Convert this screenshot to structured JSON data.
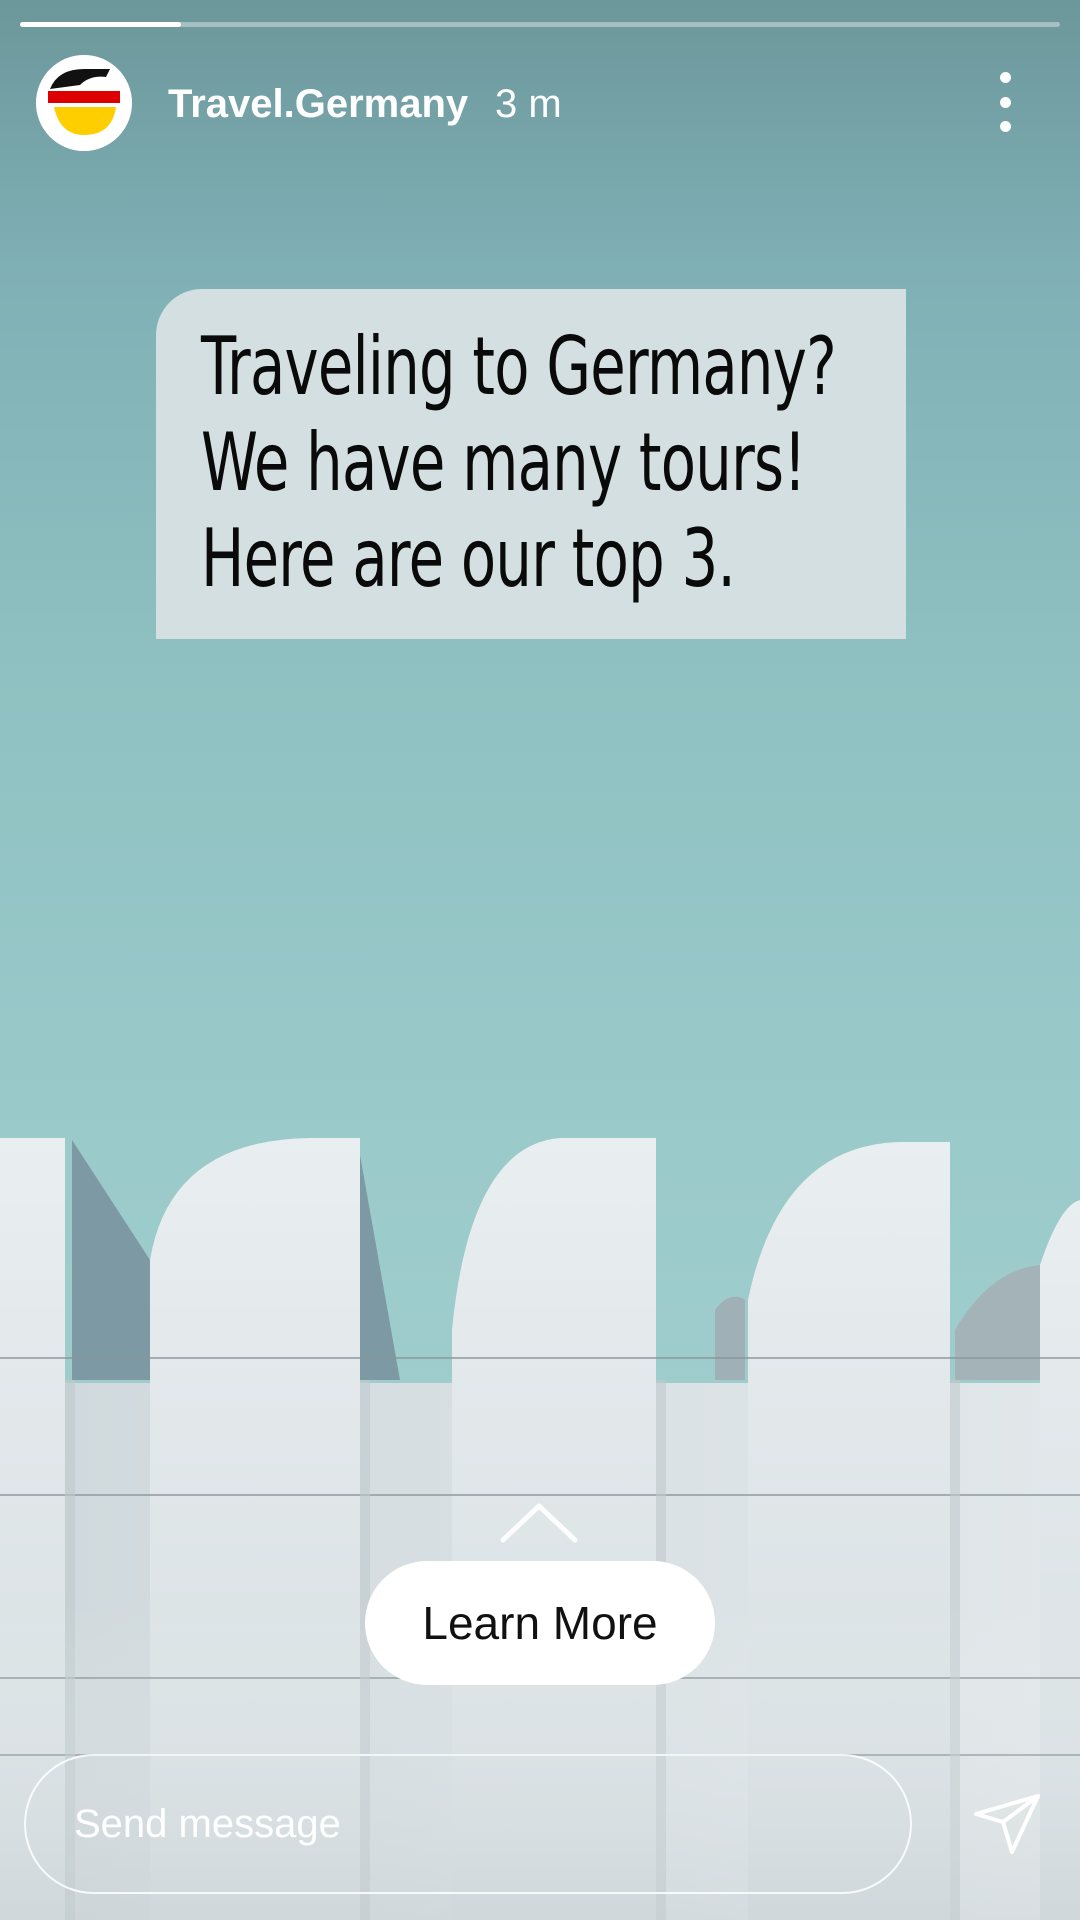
{
  "story": {
    "progress": 0.155
  },
  "header": {
    "username": "Travel.Germany",
    "time": "3 m",
    "avatar_icon": "germany-flag-logo",
    "more_icon": "more-vertical-icon"
  },
  "card": {
    "lines": [
      "Traveling to Germany?",
      "We have many tours!",
      "Here are our top 3."
    ]
  },
  "cta": {
    "icon": "chevron-up-icon",
    "label": "Learn More"
  },
  "message_bar": {
    "placeholder": "Send message",
    "send_icon": "send-icon"
  },
  "colors": {
    "flag_black": "#111111",
    "flag_red": "#dd0000",
    "flag_gold": "#ffce00",
    "card_bg": "#d3dfe0"
  }
}
